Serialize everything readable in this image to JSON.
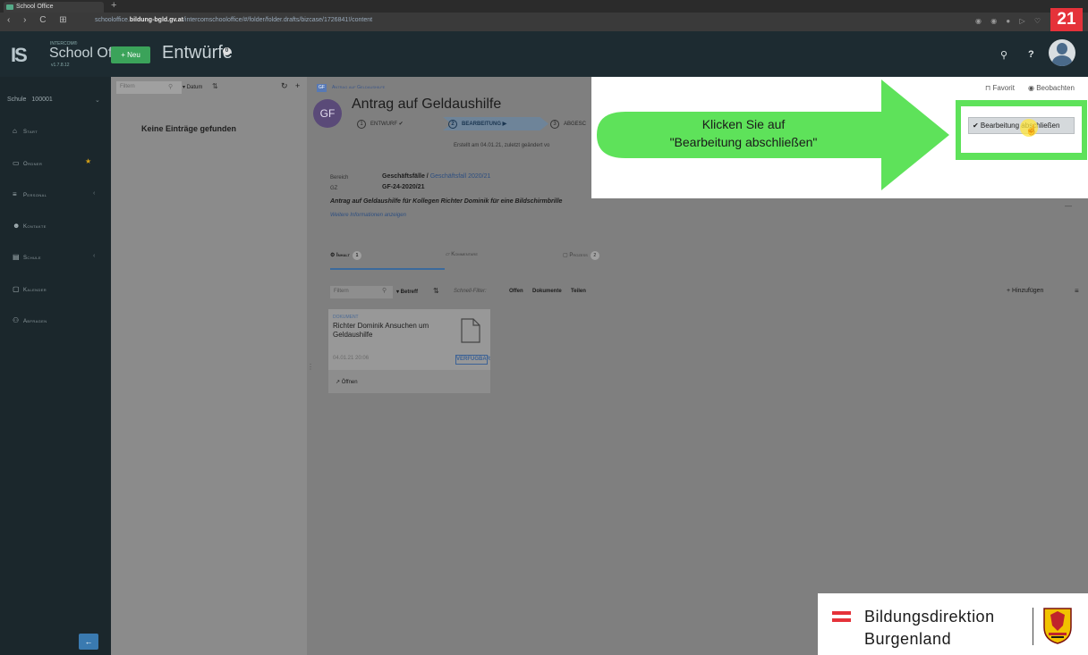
{
  "browser": {
    "tab_title": "School Office",
    "url_prefix": "schooloffice.",
    "url_host": "bildung-bgld.gv.at",
    "url_path": "/intercomschooloffice/#/folder/folder.drafts/bizcase/1726841!/content",
    "nav_buttons": "‹ › C ⊞"
  },
  "step_number": "21",
  "header": {
    "logo_small": "INTERCOM®",
    "app_name": "School Office",
    "version": "v1.7.8.12",
    "new_button": "+ Neu",
    "title": "Entwürfe",
    "badge": "0"
  },
  "sidebar": {
    "school_label": "Schule",
    "school_value": "100001",
    "items": [
      {
        "label": "Start",
        "icon": "home-icon"
      },
      {
        "label": "Ordner",
        "icon": "folder-icon"
      },
      {
        "label": "Personal",
        "icon": "personnel-icon"
      },
      {
        "label": "Kontakte",
        "icon": "contacts-icon"
      },
      {
        "label": "Schule",
        "icon": "school-icon"
      },
      {
        "label": "Kalender",
        "icon": "calendar-icon"
      },
      {
        "label": "Abfragen",
        "icon": "binoculars-icon"
      }
    ]
  },
  "list": {
    "filter_placeholder": "Filtern",
    "sort_label": "▾ Datum",
    "empty_text": "Keine Einträge gefunden"
  },
  "document": {
    "badge": "GF",
    "breadcrumb": "Antrag auf Geldaushilfe",
    "avatar": "GF",
    "title": "Antrag auf Geldaushilfe",
    "workflow": [
      {
        "num": "1",
        "label": "ENTWURF ✔"
      },
      {
        "num": "2",
        "label": "BEARBEITUNG ▶"
      },
      {
        "num": "3",
        "label": "ABGESC"
      }
    ],
    "created": "Erstellt am 04.01.21, zuletzt geändert vo",
    "area_label": "Bereich",
    "area_value": "Geschäftsfälle / ",
    "area_link": "Geschäftsfall 2020/21",
    "gz_label": "GZ",
    "gz_value": "GF-24-2020/21",
    "description": "Antrag auf Geldaushilfe für Kollegen Richter Dominik für eine Bildschirmbrille",
    "more_info": "Weitere Informationen anzeigen",
    "tabs": [
      {
        "label": "Inhalt",
        "count": "1"
      },
      {
        "label": "Kommentare",
        "count": ""
      },
      {
        "label": "Prozess",
        "count": "2"
      }
    ],
    "content_filter": "Filtern",
    "content_sort": "▾ Betreff",
    "quick_filter_label": "Schnell-Filter:",
    "quick_filters": [
      "Offen",
      "Dokumente",
      "Teilen"
    ],
    "add_label": "+ Hinzufügen",
    "card": {
      "type": "DOKUMENT",
      "title": "Richter Dominik Ansuchen um Geldaushilfe",
      "date": "04.01.21 20:06",
      "status": "VERFÜGBAR",
      "open": "Öffnen"
    }
  },
  "overlay": {
    "favorite": "Favorit",
    "watch": "Beobachten",
    "callout_line1": "Klicken Sie auf",
    "callout_line2": "\"Bearbeitung abschließen\"",
    "finish_button": "✔ Bearbeitung abschließen",
    "arrow_color": "#5ee25a"
  },
  "branding": {
    "line1": "Bildungsdirektion",
    "line2": "Burgenland",
    "flag_color": "#e5323a"
  }
}
